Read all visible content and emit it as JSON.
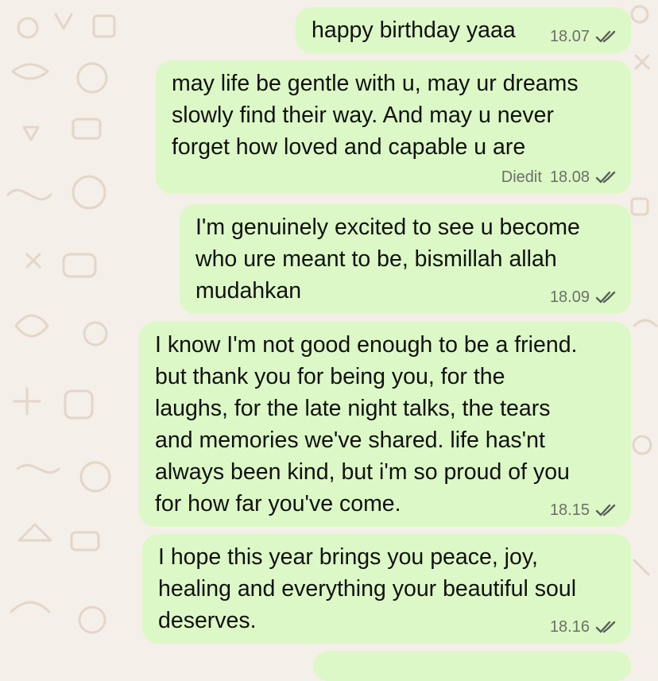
{
  "messages": [
    {
      "text": "happy birthday yaaa",
      "time": "18.07",
      "status": "read"
    },
    {
      "text": "may life be gentle with u, may ur dreams\nslowly find their way. And may u never\nforget how loved and capable u are",
      "edited_label": "Diedit",
      "time": "18.08",
      "status": "read"
    },
    {
      "text": "I'm genuinely excited to see u become\nwho ure meant to be, bismillah allah\nmudahkan",
      "time": "18.09",
      "status": "read"
    },
    {
      "text": "I know I'm not good enough to be a friend.\nbut thank you for being you, for the\nlaughs, for the late night talks, the tears\nand memories we've shared. life has'nt\nalways been kind, but i'm so proud of you\nfor how far you've come.",
      "time": "18.15",
      "status": "read"
    },
    {
      "text": "I hope this year brings you peace, joy,\nhealing and everything your beautiful soul\ndeserves.",
      "time": "18.16",
      "status": "read"
    }
  ],
  "theme": {
    "wallpaper_color": "#f4efe8",
    "bubble_color": "#dcf8c6",
    "text_color": "#111111",
    "meta_color": "#6b7068"
  },
  "icons": {
    "read_receipt": "double-check-icon"
  }
}
